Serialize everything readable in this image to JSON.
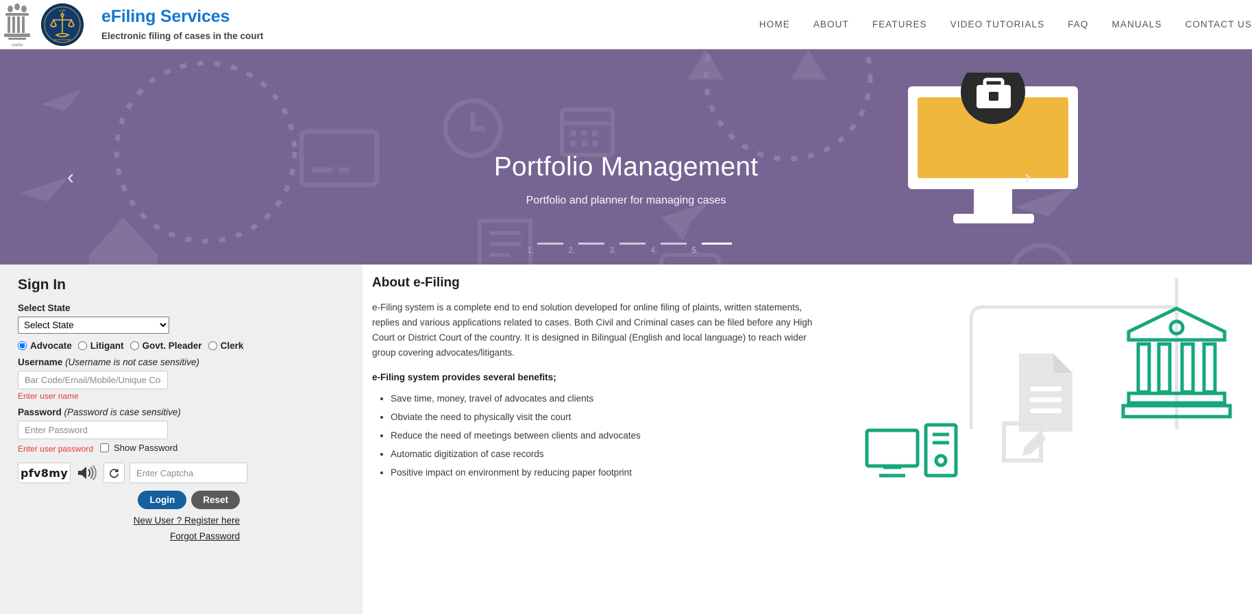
{
  "header": {
    "emblem_icon": "india-state-emblem-icon",
    "seal_icon": "ecourts-india-seal-icon",
    "title": "eFiling Services",
    "subtitle": "Electronic filing of cases in the court",
    "nav": [
      {
        "label": "HOME"
      },
      {
        "label": "ABOUT"
      },
      {
        "label": "FEATURES"
      },
      {
        "label": "VIDEO TUTORIALS"
      },
      {
        "label": "FAQ"
      },
      {
        "label": "MANUALS"
      },
      {
        "label": "CONTACT US"
      }
    ]
  },
  "hero": {
    "title": "Portfolio Management",
    "subtitle": "Portfolio and planner for managing cases",
    "prev_icon": "chevron-left-icon",
    "next_icon": "chevron-right-icon",
    "slides": [
      {
        "num": "1."
      },
      {
        "num": "2."
      },
      {
        "num": "3."
      },
      {
        "num": "4."
      },
      {
        "num": "5."
      }
    ],
    "active_slide": 5,
    "background_color": "#766593"
  },
  "signin": {
    "heading": "Sign In",
    "state_label": "Select State",
    "state_value": "Select State",
    "state_options": [
      "Select State"
    ],
    "roles": [
      {
        "label": "Advocate",
        "selected": true
      },
      {
        "label": "Litigant",
        "selected": false
      },
      {
        "label": "Govt. Pleader",
        "selected": false
      },
      {
        "label": "Clerk",
        "selected": false
      }
    ],
    "username_label": "Username",
    "username_hint": "(Username is not case sensitive)",
    "username_placeholder": "Bar Code/Email/Mobile/Unique Code",
    "username_value": "",
    "username_error": "Enter user name",
    "password_label": "Password",
    "password_hint": "(Password is case sensitive)",
    "password_placeholder": "Enter Password",
    "password_value": "",
    "password_error": "Enter user password",
    "show_password_label": "Show Password",
    "show_password_checked": false,
    "captcha_text": "pfv8my",
    "captcha_audio_icon": "speaker-icon",
    "captcha_refresh_icon": "refresh-icon",
    "captcha_placeholder": "Enter Captcha",
    "captcha_value": "",
    "login_label": "Login",
    "reset_label": "Reset",
    "register_link": "New User ? Register here",
    "forgot_link": "Forgot Password",
    "error_color": "#e23a2e",
    "login_color": "#15609e",
    "reset_color": "#5a5a5a"
  },
  "about": {
    "heading": "About e-Filing",
    "paragraph": "e-Filing system is a complete end to end solution developed for online filing of plaints, written statements, replies and various applications related to cases. Both Civil and Criminal cases can be filed before any High Court or District Court of the country. It is designed in Bilingual (English and local language) to reach wider group covering advocates/litigants.",
    "benefits_heading": "e-Filing system provides several benefits;",
    "benefits": [
      "Save time, money, travel of advocates and clients",
      "Obviate the need to physically visit the court",
      "Reduce the need of meetings between clients and advocates",
      "Automatic digitization of case records",
      "Positive impact on environment by reducing paper footprint"
    ],
    "illustration_icons": [
      "courthouse-icon",
      "document-icon",
      "pencil-document-icon",
      "monitor-tower-icon"
    ],
    "illustration_accent_color": "#16a77c"
  }
}
